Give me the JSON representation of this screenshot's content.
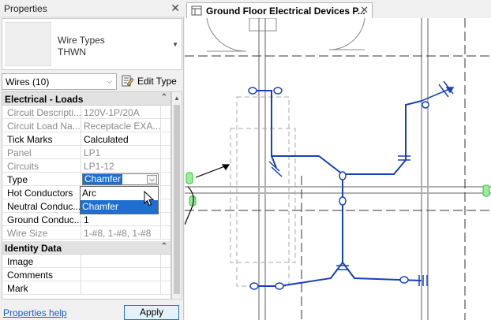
{
  "properties": {
    "panel_title": "Properties",
    "close_glyph": "✕",
    "type_selector": {
      "family": "Wire Types",
      "type": "THWN",
      "dropdown_glyph": "▼"
    },
    "instance_filter": {
      "value": "Wires (10)",
      "chevron": "⌵"
    },
    "edit_type_label": "Edit Type",
    "sections": [
      {
        "label": "Electrical - Loads",
        "toggle": "⌃"
      },
      {
        "label": "Identity Data",
        "toggle": "⌃"
      }
    ],
    "rows": [
      {
        "name": "Circuit Descripti...",
        "value": "120V-1P/20A",
        "dim": true
      },
      {
        "name": "Circuit Load Na...",
        "value": "Receptacle EXA...",
        "dim": true
      },
      {
        "name": "Tick Marks",
        "value": "Calculated",
        "dim": false
      },
      {
        "name": "Panel",
        "value": "LP1",
        "dim": true
      },
      {
        "name": "Circuits",
        "value": "LP1-12",
        "dim": true
      },
      {
        "name": "Type",
        "value": "Chamfer",
        "dim": false
      },
      {
        "name": "Hot Conductors",
        "value": "",
        "dim": false
      },
      {
        "name": "Neutral Conduc...",
        "value": "",
        "dim": false
      },
      {
        "name": "Ground Conduc...",
        "value": "1",
        "dim": false
      },
      {
        "name": "Wire Size",
        "value": "1-#8, 1-#8, 1-#8",
        "dim": true
      },
      {
        "name": "Image",
        "value": "",
        "dim": false
      },
      {
        "name": "Comments",
        "value": "",
        "dim": false
      },
      {
        "name": "Mark",
        "value": "",
        "dim": false
      }
    ],
    "type_dropdown": {
      "selected": "Chamfer",
      "options": [
        "Arc",
        "Chamfer"
      ],
      "highlighted": "Chamfer"
    },
    "help_link": "Properties help",
    "apply_label": "Apply"
  },
  "view": {
    "tab_title": "Ground Floor Electrical Devices P...",
    "close_glyph": "✕",
    "wire_color": "#1840b8",
    "grid_color": "#b0b0b0",
    "device_color": "#3fcf3f"
  },
  "colors": {
    "selection": "#1e6fd0",
    "link": "#1a5ec9"
  }
}
